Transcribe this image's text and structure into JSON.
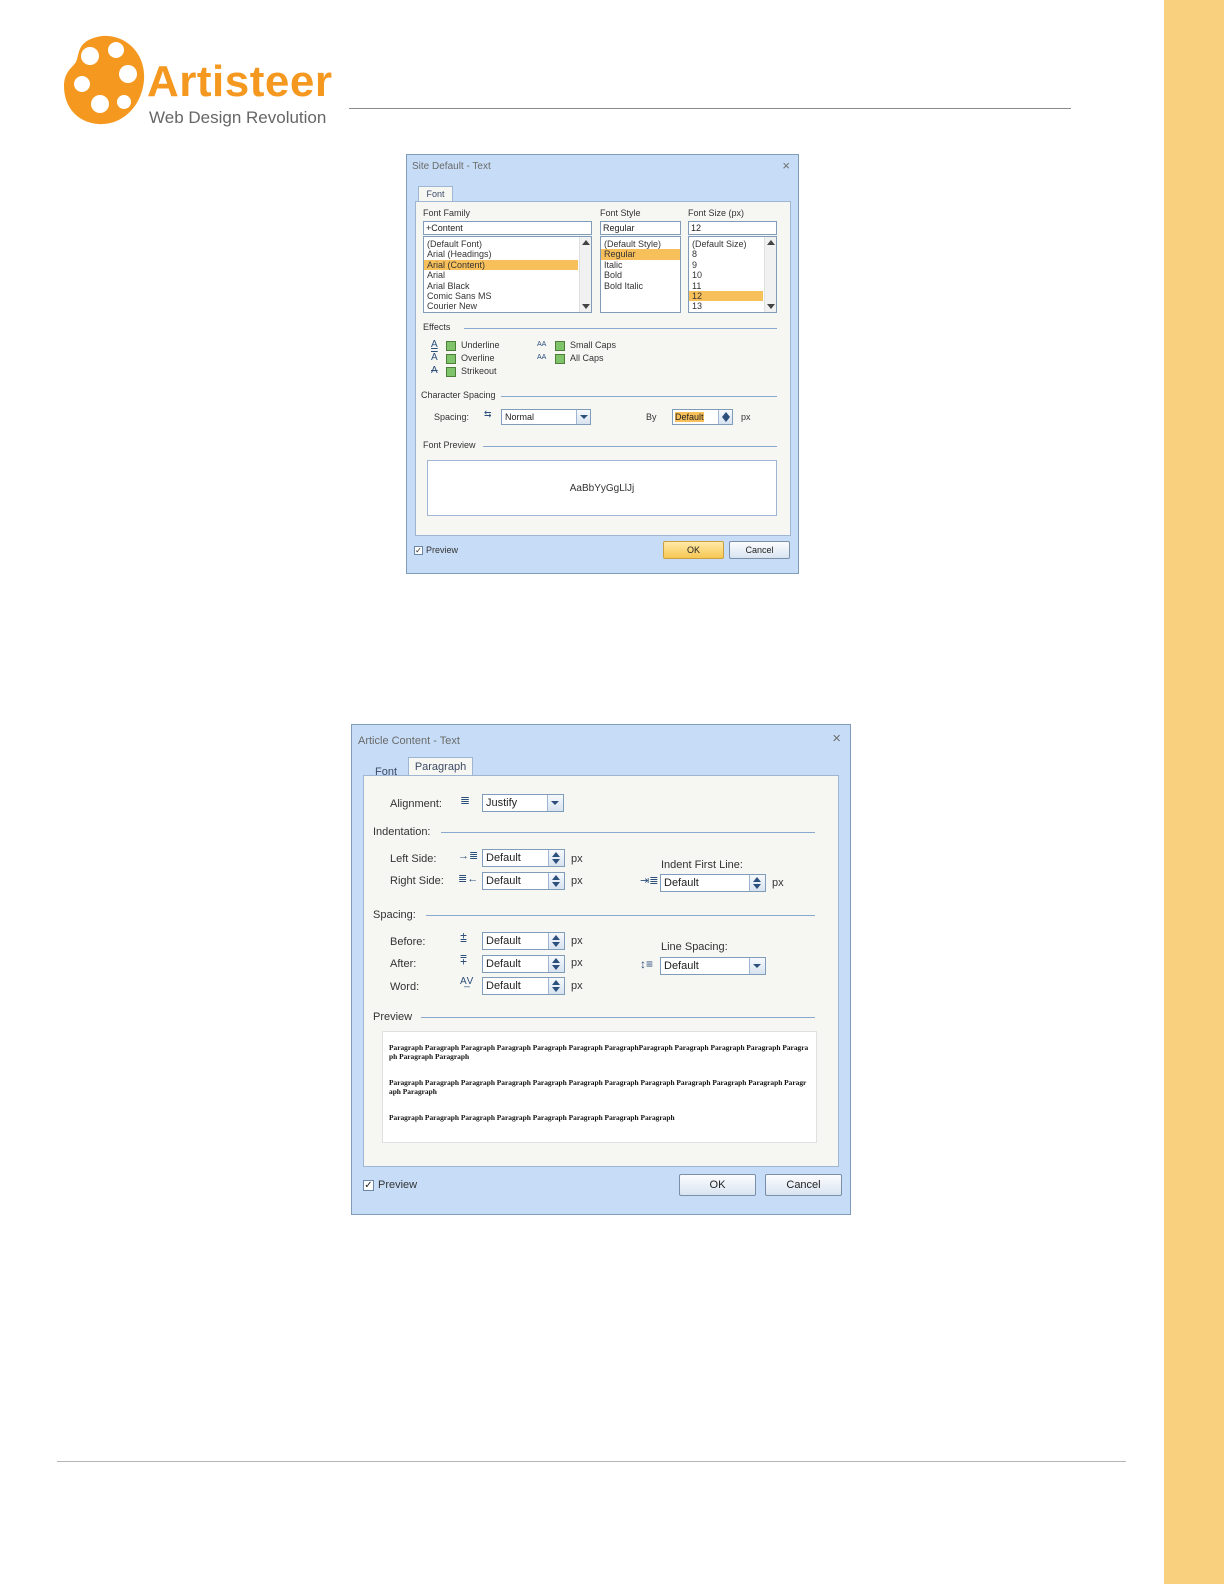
{
  "brand": {
    "name": "Artisteer",
    "tagline": "Web Design Revolution",
    "color": "#f5981f"
  },
  "dialog1": {
    "title": "Site Default - Text",
    "close": "×",
    "tab": "Font",
    "font_family": {
      "label": "Font Family",
      "value": "+Content",
      "items": [
        "(Default Font)",
        "Arial (Headings)",
        "Arial (Content)",
        "Arial",
        "Arial Black",
        "Comic Sans MS",
        "Courier New"
      ],
      "selected": "Arial (Content)"
    },
    "font_style": {
      "label": "Font Style",
      "value": "Regular",
      "items": [
        "(Default Style)",
        "Regular",
        "Italic",
        "Bold",
        "Bold Italic"
      ],
      "selected": "Regular"
    },
    "font_size": {
      "label": "Font Size (px)",
      "value": "12",
      "items": [
        "(Default Size)",
        "8",
        "9",
        "10",
        "11",
        "12",
        "13"
      ],
      "selected": "12"
    },
    "effects": {
      "label": "Effects",
      "underline": "Underline",
      "overline": "Overline",
      "strikeout": "Strikeout",
      "small_caps": "Small Caps",
      "all_caps": "All Caps"
    },
    "char_spacing": {
      "label": "Character Spacing",
      "spacing_label": "Spacing:",
      "spacing_value": "Normal",
      "by_label": "By",
      "by_value": "Default",
      "unit": "px"
    },
    "font_preview": {
      "label": "Font Preview",
      "sample": "AaBbYyGgLlJj"
    },
    "preview_label": "Preview",
    "ok": "OK",
    "cancel": "Cancel"
  },
  "dialog2": {
    "title": "Article Content - Text",
    "close": "×",
    "tabs": [
      "Font",
      "Paragraph"
    ],
    "alignment": {
      "label": "Alignment:",
      "value": "Justify"
    },
    "indentation": {
      "label": "Indentation:",
      "left_label": "Left Side:",
      "left_value": "Default",
      "right_label": "Right Side:",
      "right_value": "Default",
      "first_label": "Indent First Line:",
      "first_value": "Default",
      "unit": "px"
    },
    "spacing": {
      "label": "Spacing:",
      "before_label": "Before:",
      "before_value": "Default",
      "after_label": "After:",
      "after_value": "Default",
      "word_label": "Word:",
      "word_value": "Default",
      "line_label": "Line Spacing:",
      "line_value": "Default",
      "unit": "px"
    },
    "preview": {
      "label": "Preview",
      "paragraphs": [
        "Paragraph Paragraph Paragraph Paragraph Paragraph Paragraph ParagraphParagraph Paragraph Paragraph Paragraph Paragraph Paragraph Paragraph",
        "Paragraph Paragraph Paragraph Paragraph Paragraph Paragraph Paragraph Paragraph Paragraph Paragraph Paragraph Paragraph Paragraph",
        "Paragraph Paragraph Paragraph Paragraph Paragraph Paragraph Paragraph Paragraph"
      ]
    },
    "preview_label": "Preview",
    "ok": "OK",
    "cancel": "Cancel"
  }
}
